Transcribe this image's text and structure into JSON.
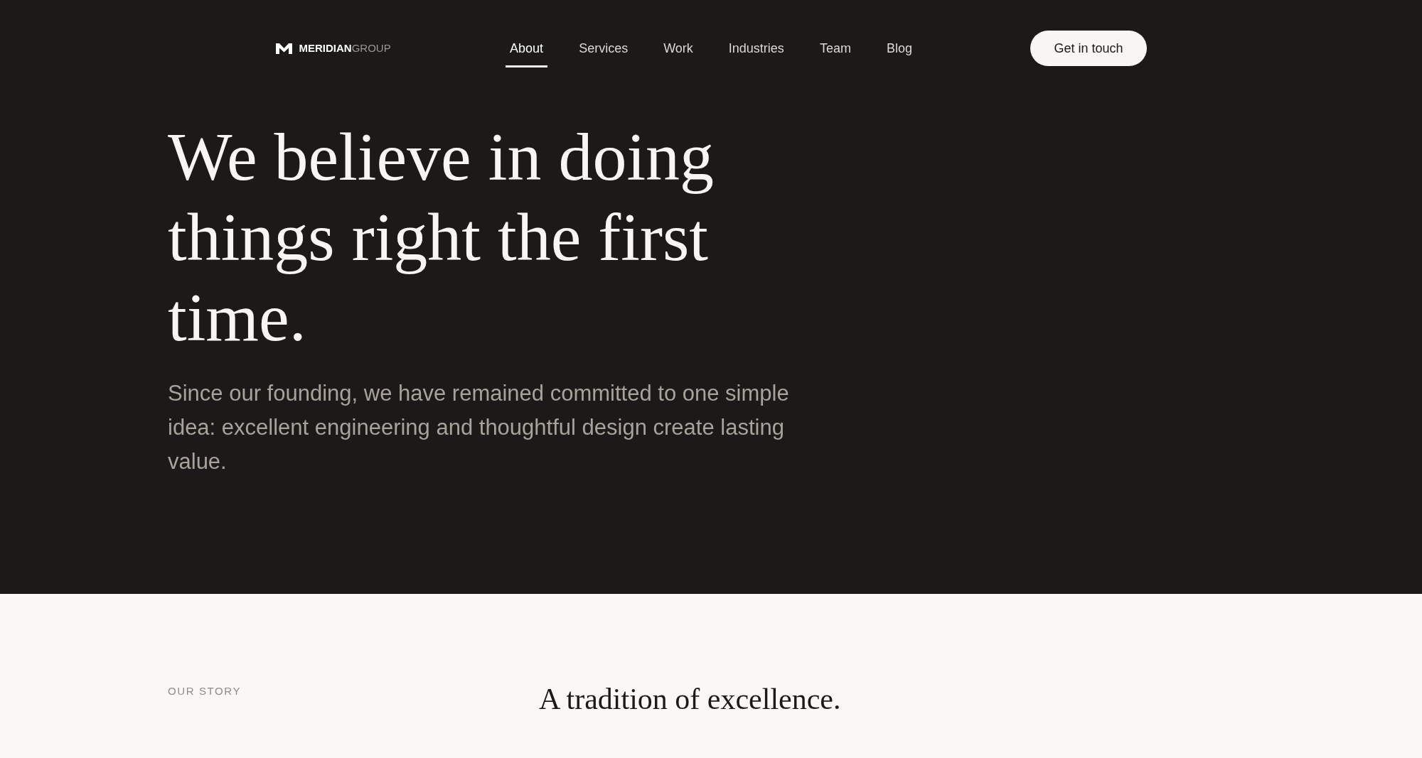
{
  "header": {
    "logo": "**MERIDIAN**GROUP",
    "nav": [
      {
        "label": "About",
        "selected": true
      },
      {
        "label": "Services",
        "selected": false
      },
      {
        "label": "Work",
        "selected": false
      },
      {
        "label": "Industries",
        "selected": false
      },
      {
        "label": "Team",
        "selected": false
      },
      {
        "label": "Blog",
        "selected": false
      }
    ],
    "cta": "Get in touch"
  },
  "hero": {
    "title": "We believe in doing things right the first time.",
    "lead": "Since our founding, we have remained committed to one simple idea: excellent engineering and thoughtful design create lasting value."
  },
  "story": {
    "eyebrow": "OUR STORY",
    "title": "A tradition of excellence."
  }
}
